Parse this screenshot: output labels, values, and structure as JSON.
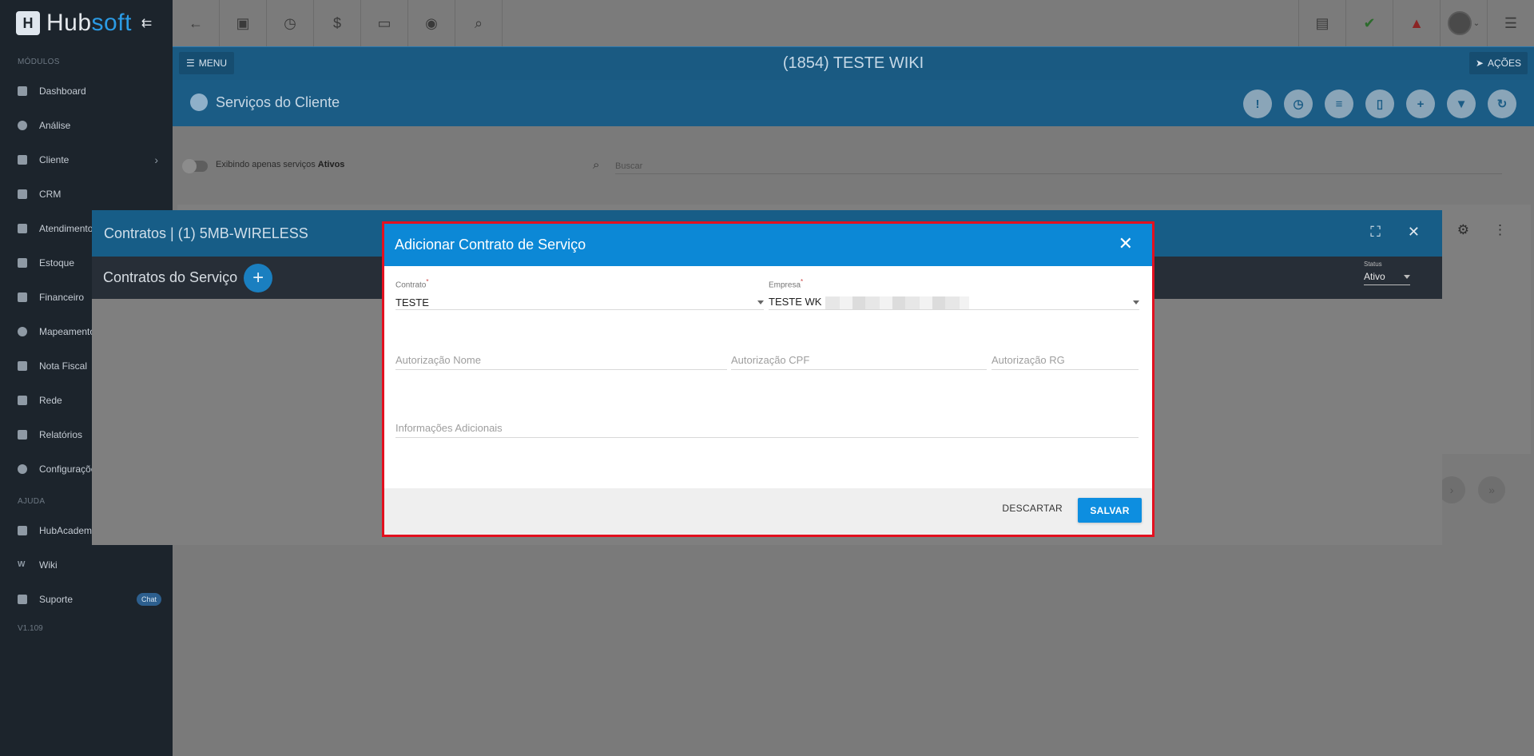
{
  "app": {
    "logo_text_1": "Hub",
    "logo_text_2": "soft",
    "collapse_icon": "collapse-arrow-icon"
  },
  "sidebar": {
    "section_modules": "MÓDULOS",
    "items": [
      {
        "label": "Dashboard",
        "icon": "dashboard-icon"
      },
      {
        "label": "Análise",
        "icon": "pie-chart-icon"
      },
      {
        "label": "Cliente",
        "icon": "contact-icon",
        "has_arrow": true
      },
      {
        "label": "CRM",
        "icon": "crm-icon"
      },
      {
        "label": "Atendimento",
        "icon": "calendar-clock-icon"
      },
      {
        "label": "Estoque",
        "icon": "box-icon"
      },
      {
        "label": "Financeiro",
        "icon": "money-icon"
      },
      {
        "label": "Mapeamento",
        "icon": "map-pin-icon"
      },
      {
        "label": "Nota Fiscal",
        "icon": "invoice-icon"
      },
      {
        "label": "Rede",
        "icon": "network-icon"
      },
      {
        "label": "Relatórios",
        "icon": "report-icon"
      },
      {
        "label": "Configurações",
        "icon": "gear-icon"
      }
    ],
    "section_help": "AJUDA",
    "help_items": [
      {
        "label": "HubAcademy",
        "icon": "youtube-icon"
      },
      {
        "label": "Wiki",
        "icon": "wiki-icon"
      },
      {
        "label": "Suporte",
        "icon": "support-icon",
        "badge": "Chat"
      }
    ],
    "version": "V1.109"
  },
  "topbar": {
    "left_icons": [
      "back-arrow-icon",
      "contact-card-icon",
      "calendar-clock-icon",
      "dollar-icon",
      "terminal-icon",
      "eye-icon",
      "search-icon"
    ],
    "right_icons": [
      "pdf-icon",
      "chat-check-icon",
      "alarm-bell-icon",
      "avatar",
      "list-icon"
    ]
  },
  "header": {
    "menu_label": "MENU",
    "title": "(1854) TESTE WIKI",
    "actions_label": "AÇÕES"
  },
  "subheader": {
    "title": "Serviços do Cliente",
    "buttons": [
      "alert-icon",
      "calendar-clock-icon",
      "list-icon",
      "document-icon",
      "plus-icon",
      "filter-icon",
      "refresh-icon"
    ]
  },
  "filter": {
    "toggle_text": "Exibindo apenas serviços ",
    "toggle_strong": "Ativos",
    "search_placeholder": "Buscar"
  },
  "contratos_modal": {
    "title": "Contratos | (1) 5MB-WIRELESS",
    "subtitle": "Contratos do Serviço",
    "status_label": "Status",
    "status_value": "Ativo"
  },
  "dialog": {
    "title": "Adicionar Contrato de Serviço",
    "contrato_label": "Contrato",
    "contrato_value": "TESTE",
    "empresa_label": "Empresa",
    "empresa_value": "TESTE WK",
    "autorizacao_nome_placeholder": "Autorização Nome",
    "autorizacao_cpf_placeholder": "Autorização CPF",
    "autorizacao_rg_placeholder": "Autorização RG",
    "informacoes_placeholder": "Informações Adicionais",
    "discard_label": "DESCARTAR",
    "save_label": "SALVAR"
  },
  "colors": {
    "dialog_header": "#0c88d6",
    "highlight_border": "#e3101f",
    "save_button": "#0d8ee0"
  }
}
